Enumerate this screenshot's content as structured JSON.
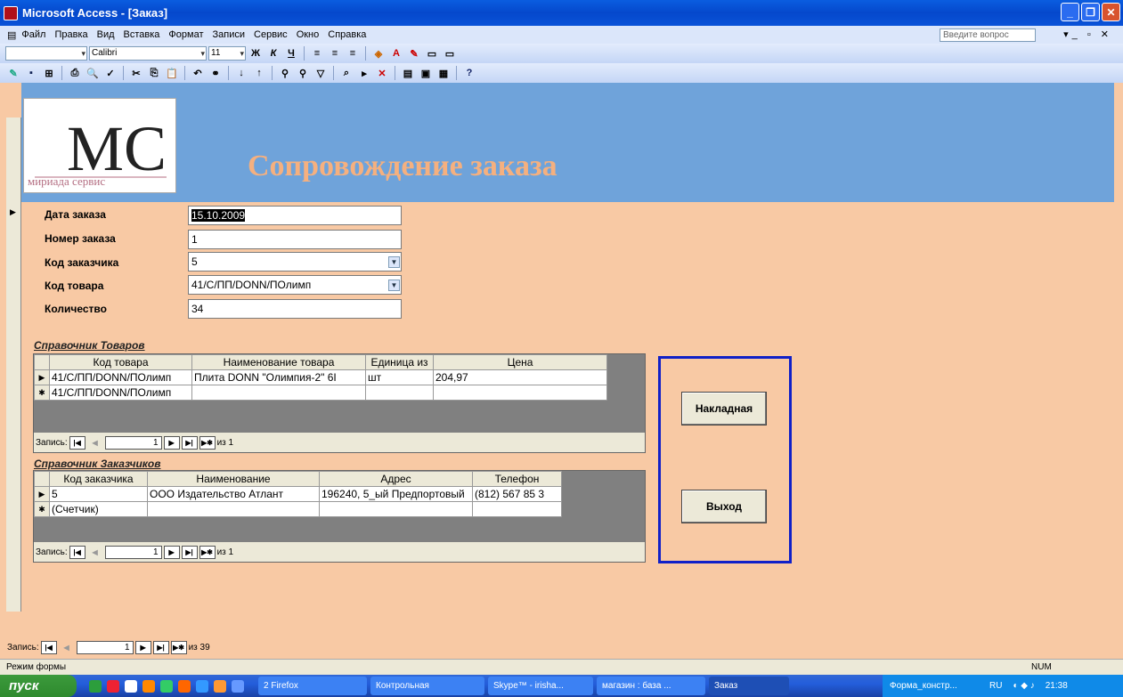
{
  "window": {
    "title": "Microsoft Access - [Заказ]"
  },
  "menu": {
    "items": [
      "Файл",
      "Правка",
      "Вид",
      "Вставка",
      "Формат",
      "Записи",
      "Сервис",
      "Окно",
      "Справка"
    ],
    "help_placeholder": "Введите вопрос"
  },
  "toolbar": {
    "font": "Calibri",
    "size": "11"
  },
  "form": {
    "title": "Сопровождение заказа",
    "logo_text": "мириада сервис",
    "logo_mark": "MC",
    "fields": [
      {
        "label": "Дата заказа",
        "value": "15.10.2009"
      },
      {
        "label": "Номер заказа",
        "value": "1"
      },
      {
        "label": "Код заказчика",
        "value": "5"
      },
      {
        "label": "Код товара",
        "value": "41/С/ПП/DONN/ПОлимп"
      },
      {
        "label": "Количество",
        "value": "34"
      }
    ]
  },
  "products": {
    "title": "Справочник Товаров",
    "columns": [
      "Код товара",
      "Наименование товара",
      "Единица из",
      "Цена"
    ],
    "rows": [
      {
        "sel": "▶",
        "cells": [
          "41/С/ПП/DONN/ПОлимп",
          "Плита DONN \"Олимпия-2\" 6I",
          "шт",
          "204,97"
        ]
      },
      {
        "sel": "✱",
        "cells": [
          "41/С/ПП/DONN/ПОлимп",
          "",
          "",
          ""
        ]
      }
    ],
    "nav": {
      "label": "Запись:",
      "current": "1",
      "of": "из 1"
    }
  },
  "customers": {
    "title": "Справочник Заказчиков",
    "columns": [
      "Код заказчика",
      "Наименование",
      "Адрес",
      "Телефон"
    ],
    "rows": [
      {
        "sel": "▶",
        "cells": [
          "5",
          "ООО Издательство Атлант",
          "196240, 5_ый Предпортовый",
          "(812) 567 85 3"
        ]
      },
      {
        "sel": "✱",
        "cells": [
          "(Счетчик)",
          "",
          "",
          ""
        ]
      }
    ],
    "nav": {
      "label": "Запись:",
      "current": "1",
      "of": "из 1"
    }
  },
  "buttons": {
    "invoice": "Накладная",
    "exit": "Выход"
  },
  "main_nav": {
    "label": "Запись:",
    "current": "1",
    "of": "из 39"
  },
  "status": {
    "mode": "Режим формы",
    "num": "NUM"
  },
  "taskbar": {
    "start": "пуск",
    "tasks": [
      "2 Firefox",
      "Контрольная",
      "Skype™ - irisha...",
      "магазин : база ...",
      "Заказ",
      "Форма_констр..."
    ],
    "lang": "RU",
    "time": "21:38"
  },
  "colors": {
    "form_bg": "#f8c9a4",
    "header_bg": "#6fa3da",
    "title": "#f5b07f",
    "frame": "#1020c8"
  }
}
